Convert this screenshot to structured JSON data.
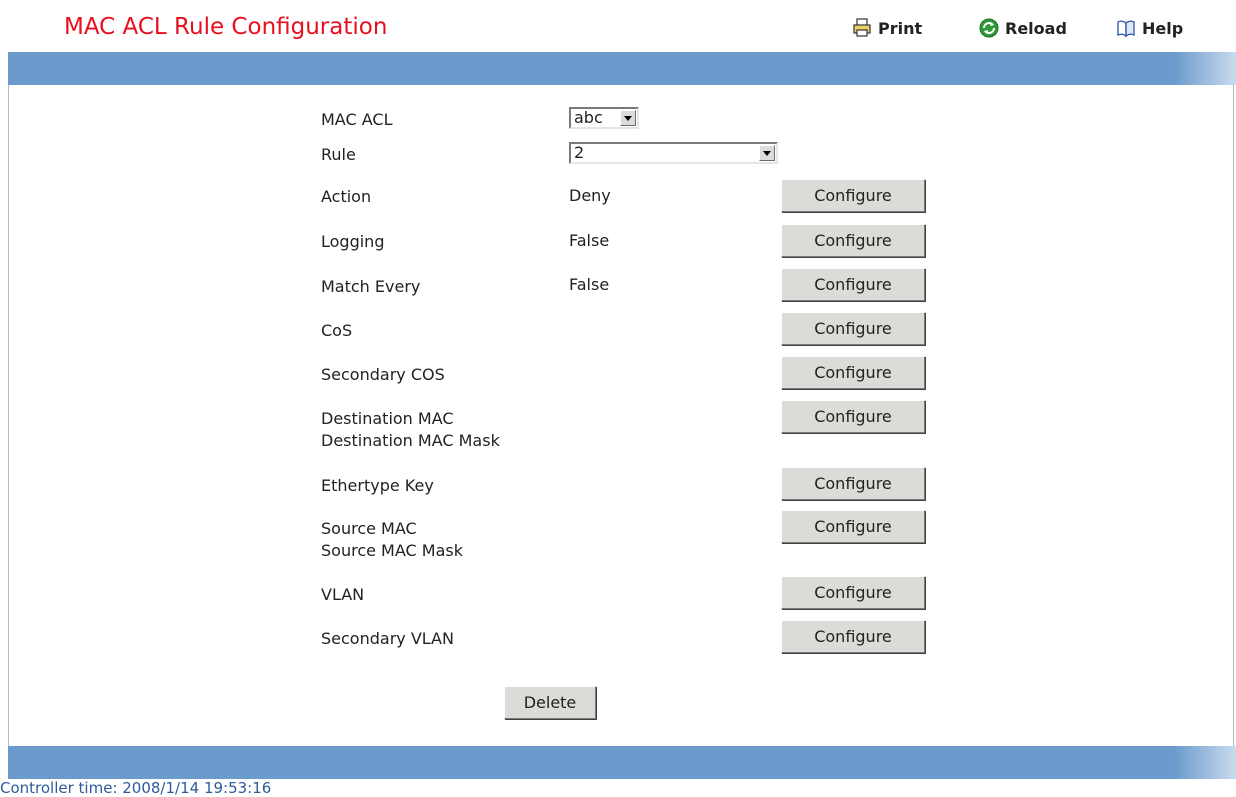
{
  "header": {
    "title": "MAC ACL Rule Configuration",
    "links": {
      "print": "Print",
      "reload": "Reload",
      "help": "Help"
    }
  },
  "form": {
    "mac_acl": {
      "label": "MAC ACL",
      "selected": "abc"
    },
    "rule": {
      "label": "Rule",
      "selected": "2"
    },
    "rows": [
      {
        "label": "Action",
        "value": "Deny",
        "button": "Configure"
      },
      {
        "label": "Logging",
        "value": "False",
        "button": "Configure"
      },
      {
        "label": "Match Every",
        "value": "False",
        "button": "Configure"
      },
      {
        "label": "CoS",
        "value": "",
        "button": "Configure"
      },
      {
        "label": "Secondary COS",
        "value": "",
        "button": "Configure"
      },
      {
        "label": "Destination MAC",
        "label2": "Destination MAC Mask",
        "value": "",
        "button": "Configure"
      },
      {
        "label": "Ethertype Key",
        "value": "",
        "button": "Configure"
      },
      {
        "label": "Source MAC",
        "label2": "Source MAC Mask",
        "value": "",
        "button": "Configure"
      },
      {
        "label": "VLAN",
        "value": "",
        "button": "Configure"
      },
      {
        "label": "Secondary VLAN",
        "value": "",
        "button": "Configure"
      }
    ],
    "delete_label": "Delete"
  },
  "footer": {
    "controller_time": "Controller time: 2008/1/14 19:53:16"
  },
  "colors": {
    "title": "#e8101e",
    "bar": "#6b9bcc",
    "footer_text": "#2e5b9a"
  },
  "icons": {
    "print": "printer-icon",
    "reload": "reload-icon",
    "help": "book-icon"
  }
}
